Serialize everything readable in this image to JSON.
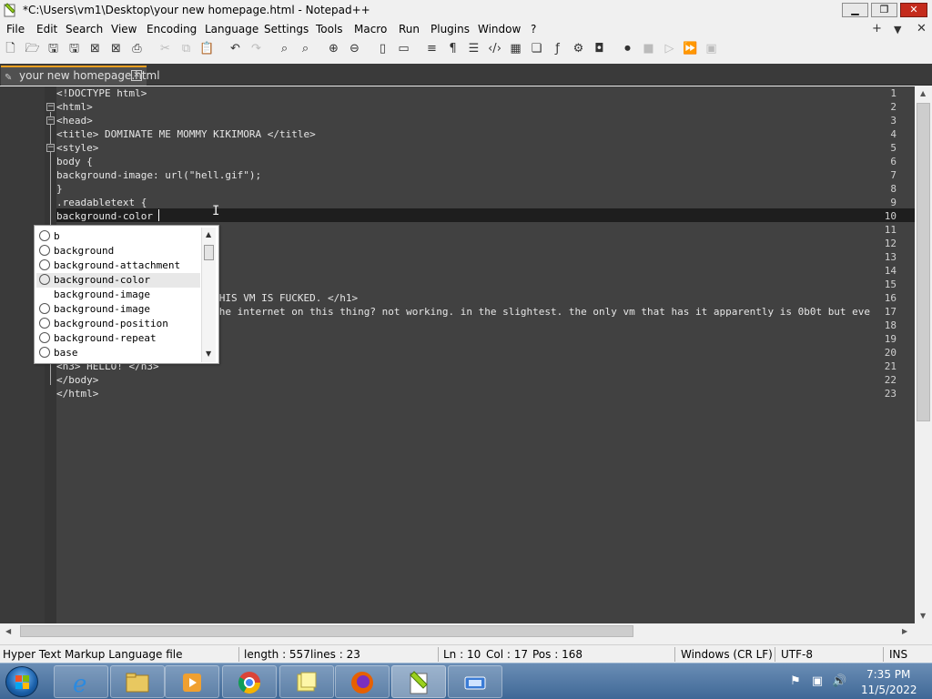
{
  "window": {
    "title": "*C:\\Users\\vm1\\Desktop\\your new homepage.html - Notepad++",
    "minimize": "▁",
    "restore": "❐",
    "close": "✕"
  },
  "menu": {
    "items": [
      "File",
      "Edit",
      "Search",
      "View",
      "Encoding",
      "Language",
      "Settings",
      "Tools",
      "Macro",
      "Run",
      "Plugins",
      "Window",
      "?"
    ],
    "right_plus": "+",
    "right_down": "▼",
    "right_close": "✕"
  },
  "tab": {
    "label": "your new homepage.html",
    "close": "✕"
  },
  "editor": {
    "line_numbers": [
      "1",
      "2",
      "3",
      "4",
      "5",
      "6",
      "7",
      "8",
      "9",
      "10",
      "11",
      "12",
      "13",
      "14",
      "15",
      "16",
      "17",
      "18",
      "19",
      "20",
      "21",
      "22",
      "23"
    ],
    "lines": [
      "<!DOCTYPE html>",
      "<html>",
      "<head>",
      "<title> DOMINATE ME MOMMY KIKIMORA </title>",
      "<style>",
      "body {",
      "background-image: url(\"hell.gif\");",
      "}",
      ".readabletext {",
      "background-color",
      "",
      "",
      "",
      "",
      "",
      "                          THIS VM IS FUCKED. </h1>",
      "                          the internet on this thing? not working. in the slightest. the only vm that has it apparently is 0b0t but eve",
      "",
      "",
      "",
      "<h3> HELLO! </h3>",
      "</body>",
      "</html>"
    ]
  },
  "autocomplete": {
    "items": [
      "b",
      "background",
      "background-attachment",
      "background-color",
      "background-image",
      "background-image",
      "background-position",
      "background-repeat",
      "base"
    ],
    "selected_index": 3
  },
  "status": {
    "file_type": "Hyper Text Markup Language file",
    "length": "length : 557",
    "lines": "lines : 23",
    "ln": "Ln : 10",
    "col": "Col : 17",
    "pos": "Pos : 168",
    "eol": "Windows (CR LF)",
    "encoding": "UTF-8",
    "mode": "INS"
  },
  "taskbar": {
    "time": "7:35 PM",
    "date": "11/5/2022"
  }
}
